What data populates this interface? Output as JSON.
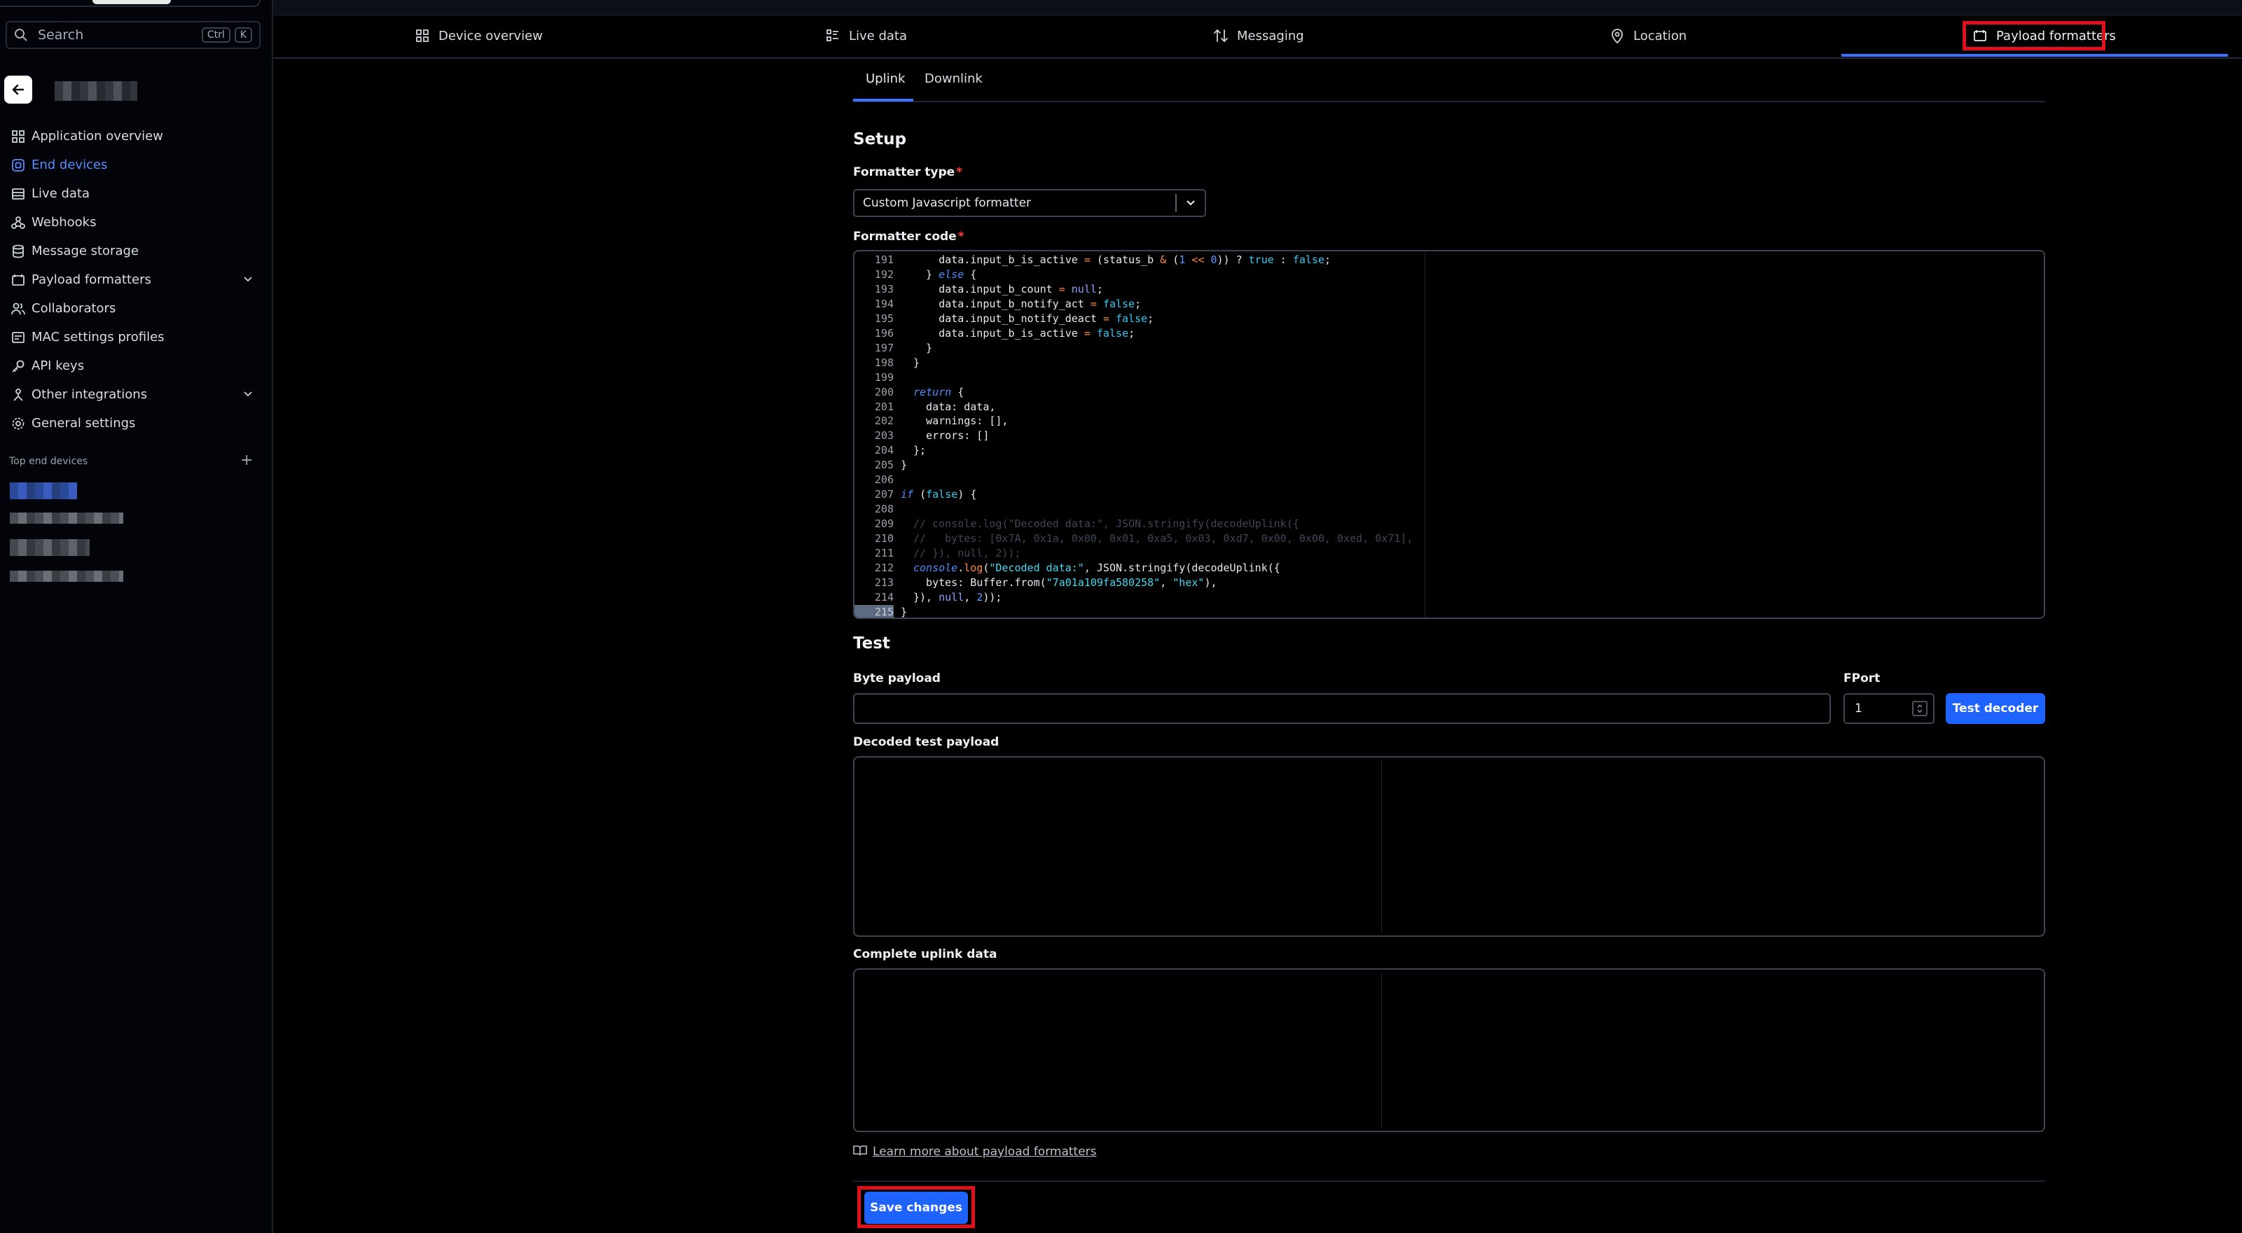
{
  "search": {
    "placeholder": "Search",
    "kbd_ctrl": "Ctrl",
    "kbd_k": "K"
  },
  "sidebar": {
    "items": [
      {
        "label": "Application overview",
        "icon": "grid-icon"
      },
      {
        "label": "End devices",
        "icon": "device-icon",
        "active": true
      },
      {
        "label": "Live data",
        "icon": "list-icon"
      },
      {
        "label": "Webhooks",
        "icon": "webhook-icon"
      },
      {
        "label": "Message storage",
        "icon": "database-icon"
      },
      {
        "label": "Payload formatters",
        "icon": "code-icon",
        "expandable": true
      },
      {
        "label": "Collaborators",
        "icon": "users-icon"
      },
      {
        "label": "MAC settings profiles",
        "icon": "settings-list-icon"
      },
      {
        "label": "API keys",
        "icon": "key-icon"
      },
      {
        "label": "Other integrations",
        "icon": "integrations-icon",
        "expandable": true
      },
      {
        "label": "General settings",
        "icon": "gear-icon"
      }
    ],
    "section_title": "Top end devices"
  },
  "tabs": [
    {
      "label": "Device overview",
      "icon": "grid-icon"
    },
    {
      "label": "Live data",
      "icon": "list-icon"
    },
    {
      "label": "Messaging",
      "icon": "arrows-icon"
    },
    {
      "label": "Location",
      "icon": "pin-icon"
    },
    {
      "label": "Payload formatters",
      "icon": "code-icon",
      "active": true
    }
  ],
  "subtabs": [
    {
      "label": "Uplink",
      "active": true
    },
    {
      "label": "Downlink"
    }
  ],
  "setup": {
    "title": "Setup",
    "formatter_type_label": "Formatter type",
    "formatter_type_value": "Custom Javascript formatter",
    "formatter_code_label": "Formatter code"
  },
  "code_lines": [
    {
      "n": "191",
      "html": "    data.input_b_is_active <span class=\"op\">=</span> (status_b <span class=\"op\">&amp;</span> (<span class=\"num\">1</span> <span class=\"op\">&lt;&lt;</span> <span class=\"num\">0</span>)) ? <span class=\"b\">true</span> : <span class=\"b\">false</span>;"
    },
    {
      "n": "192",
      "html": "  } <span class=\"k\">else</span> {"
    },
    {
      "n": "193",
      "html": "    data.input_b_count <span class=\"op\">=</span> <span class=\"n\">null</span>;"
    },
    {
      "n": "194",
      "html": "    data.input_b_notify_act <span class=\"op\">=</span> <span class=\"b\">false</span>;"
    },
    {
      "n": "195",
      "html": "    data.input_b_notify_deact <span class=\"op\">=</span> <span class=\"b\">false</span>;"
    },
    {
      "n": "196",
      "html": "    data.input_b_is_active <span class=\"op\">=</span> <span class=\"b\">false</span>;"
    },
    {
      "n": "197",
      "html": "  }"
    },
    {
      "n": "198",
      "html": "}"
    },
    {
      "n": "199",
      "html": ""
    },
    {
      "n": "200",
      "html": "<span class=\"k\">return</span> {"
    },
    {
      "n": "201",
      "html": "  data: data,"
    },
    {
      "n": "202",
      "html": "  warnings: [],"
    },
    {
      "n": "203",
      "html": "  errors: []"
    },
    {
      "n": "204",
      "html": "};"
    },
    {
      "n": "205",
      "html": "<span style=\"margin-left:-18px\">}</span>"
    },
    {
      "n": "206",
      "html": ""
    },
    {
      "n": "207",
      "html": "<span style=\"margin-left:-18px\"><span class=\"k\">if</span> (<span class=\"b\">false</span>) {</span>"
    },
    {
      "n": "208",
      "html": ""
    },
    {
      "n": "209",
      "html": "<span class=\"cmt\">// console.log(\"Decoded data:\", JSON.stringify(decodeUplink({</span>"
    },
    {
      "n": "210",
      "html": "<span class=\"cmt\">//   bytes: [0x7A, 0x1a, 0x00, 0x01, 0xa5, 0x03, 0xd7, 0x00, 0x00, 0xed, 0x71],</span>"
    },
    {
      "n": "211",
      "html": "<span class=\"cmt\">// }), null, 2));</span>"
    },
    {
      "n": "212",
      "html": "<span class=\"k\">console</span>.<span class=\"op\">log</span>(<span class=\"s\">\"Decoded data:\"</span>, JSON.stringify(decodeUplink({"
    },
    {
      "n": "213",
      "html": "  bytes: Buffer.from(<span class=\"s\">\"7a01a109fa580258\"</span>, <span class=\"s\">\"hex\"</span>),"
    },
    {
      "n": "214",
      "html": "}), <span class=\"n\">null</span>, <span class=\"num\">2</span>));"
    },
    {
      "n": "215",
      "html": "<span style=\"margin-left:-18px\">}</span>",
      "cur": true
    }
  ],
  "test": {
    "title": "Test",
    "byte_payload_label": "Byte payload",
    "byte_payload_value": "",
    "fport_label": "FPort",
    "fport_value": "1",
    "test_button": "Test decoder",
    "decoded_label": "Decoded test payload",
    "complete_label": "Complete uplink data"
  },
  "learn_more": "Learn more about payload formatters",
  "save_button": "Save changes",
  "colors": {
    "accent": "#1f63ff",
    "highlight": "#e0101c",
    "active_text": "#5b8cff"
  }
}
